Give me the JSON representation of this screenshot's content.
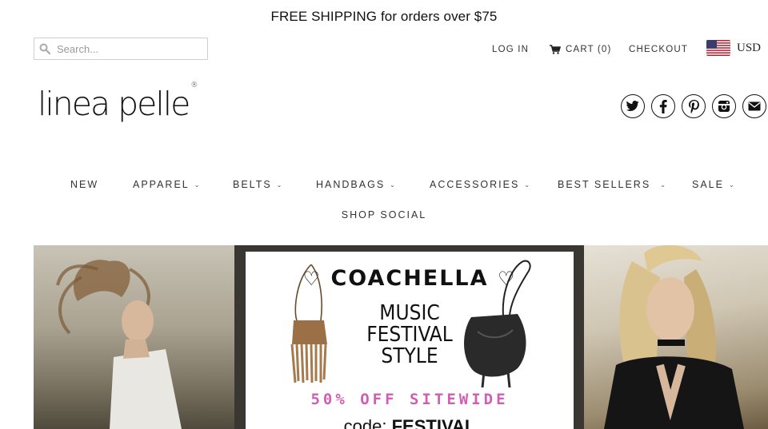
{
  "announcement": "FREE SHIPPING for orders over $75",
  "search": {
    "placeholder": "Search..."
  },
  "header_links": {
    "login": "LOG IN",
    "cart_label": "CART",
    "cart_count": "(0)",
    "checkout": "CHECKOUT"
  },
  "currency": {
    "code": "USD",
    "flag_icon": "us-flag-icon"
  },
  "logo": {
    "text": "linea pelle",
    "mark": "®"
  },
  "social": [
    "twitter-icon",
    "facebook-icon",
    "pinterest-icon",
    "instagram-icon",
    "email-icon"
  ],
  "main_nav": {
    "new": "NEW",
    "apparel": "APPAREL",
    "belts": "BELTS",
    "handbags": "HANDBAGS",
    "accessories": "ACCESSORIES",
    "best_sellers": "BEST SELLERS",
    "sale": "SALE",
    "shop_social": "SHOP SOCIAL"
  },
  "banner": {
    "title": "COACHELLA",
    "line1": "MUSIC",
    "line2": "FESTIVAL",
    "line3": "STYLE",
    "offer": "50% OFF SITEWIDE",
    "code_prefix": "code:",
    "code_value": "FESTIVAL"
  },
  "colors": {
    "offer_pink": "#d05fb1",
    "text": "#333333"
  }
}
